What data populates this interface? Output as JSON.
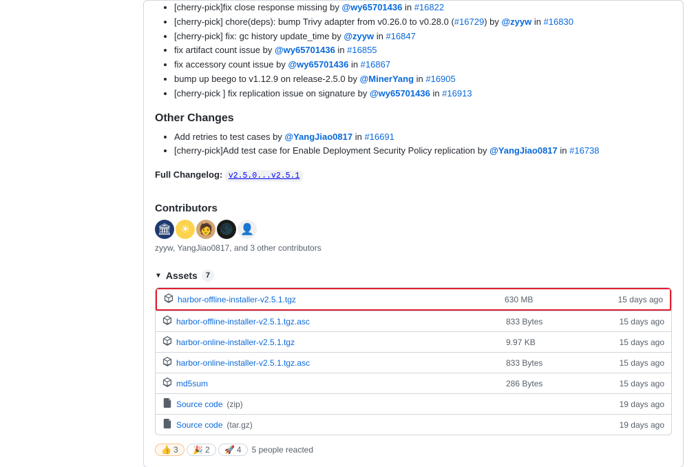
{
  "changes1": [
    {
      "prefix": "[cherry-pick]fix close response missing by ",
      "user": "@wy65701436",
      "mid": " in ",
      "issue": "#16822"
    },
    {
      "prefix": "[cherry-pick] chore(deps): bump Trivy adapter from v0.26.0 to v0.28.0 (",
      "preIssue": "#16729",
      "afterPreIssue": ") by ",
      "user": "@zyyw",
      "mid": " in ",
      "issue": "#16830"
    },
    {
      "prefix": "[cherry-pick] fix: gc history update_time by ",
      "user": "@zyyw",
      "mid": " in ",
      "issue": "#16847"
    },
    {
      "prefix": "fix artifact count issue by ",
      "user": "@wy65701436",
      "mid": " in ",
      "issue": "#16855"
    },
    {
      "prefix": "fix accessory count issue by ",
      "user": "@wy65701436",
      "mid": " in ",
      "issue": "#16867"
    },
    {
      "prefix": "bump up beego to v1.12.9 on release-2.5.0 by ",
      "user": "@MinerYang",
      "mid": " in ",
      "issue": "#16905"
    },
    {
      "prefix": "[cherry-pick ] fix replication issue on signature by ",
      "user": "@wy65701436",
      "mid": " in ",
      "issue": "#16913"
    }
  ],
  "other_heading": "Other Changes",
  "changes2": [
    {
      "prefix": "Add retries to test cases by ",
      "user": "@YangJiao0817",
      "mid": " in ",
      "issue": "#16691"
    },
    {
      "prefix": "[cherry-pick]Add test case for Enable Deployment Security Policy replication by ",
      "user": "@YangJiao0817",
      "mid": " in ",
      "issue": "#16738"
    }
  ],
  "changelog_label": "Full Changelog: ",
  "changelog_range": "v2.5.0...v2.5.1",
  "contributors": {
    "heading": "Contributors",
    "subtext": "zyyw, YangJiao0817, and 3 other contributors"
  },
  "assets": {
    "heading": "Assets",
    "count": "7",
    "rows": [
      {
        "name": "harbor-offline-installer-v2.5.1.tgz",
        "size": "630 MB",
        "date": "15 days ago",
        "highlight": true,
        "type": "pkg"
      },
      {
        "name": "harbor-offline-installer-v2.5.1.tgz.asc",
        "size": "833 Bytes",
        "date": "15 days ago",
        "type": "pkg"
      },
      {
        "name": "harbor-online-installer-v2.5.1.tgz",
        "size": "9.97 KB",
        "date": "15 days ago",
        "type": "pkg"
      },
      {
        "name": "harbor-online-installer-v2.5.1.tgz.asc",
        "size": "833 Bytes",
        "date": "15 days ago",
        "type": "pkg"
      },
      {
        "name": "md5sum",
        "size": "286 Bytes",
        "date": "15 days ago",
        "type": "pkg"
      },
      {
        "name": "Source code",
        "suffix": "(zip)",
        "size": "",
        "date": "19 days ago",
        "type": "zip"
      },
      {
        "name": "Source code",
        "suffix": "(tar.gz)",
        "size": "",
        "date": "19 days ago",
        "type": "zip"
      }
    ]
  },
  "reactions": {
    "items": [
      {
        "emoji": "👍",
        "count": "3",
        "accent": true
      },
      {
        "emoji": "🎉",
        "count": "2"
      },
      {
        "emoji": "🚀",
        "count": "4"
      }
    ],
    "summary": "5 people reacted"
  }
}
